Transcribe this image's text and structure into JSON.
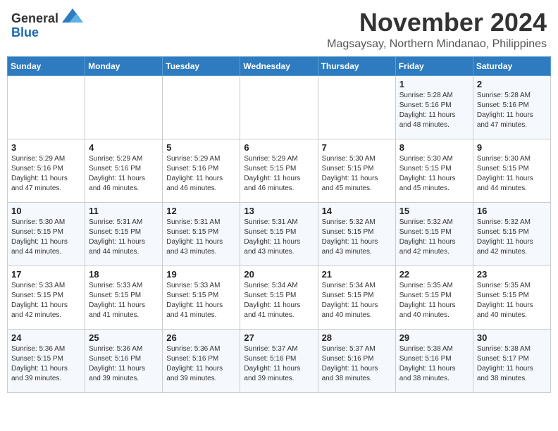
{
  "header": {
    "logo_general": "General",
    "logo_blue": "Blue",
    "month_title": "November 2024",
    "location": "Magsaysay, Northern Mindanao, Philippines"
  },
  "calendar": {
    "days_of_week": [
      "Sunday",
      "Monday",
      "Tuesday",
      "Wednesday",
      "Thursday",
      "Friday",
      "Saturday"
    ],
    "weeks": [
      [
        {
          "day": "",
          "info": ""
        },
        {
          "day": "",
          "info": ""
        },
        {
          "day": "",
          "info": ""
        },
        {
          "day": "",
          "info": ""
        },
        {
          "day": "",
          "info": ""
        },
        {
          "day": "1",
          "info": "Sunrise: 5:28 AM\nSunset: 5:16 PM\nDaylight: 11 hours and 48 minutes."
        },
        {
          "day": "2",
          "info": "Sunrise: 5:28 AM\nSunset: 5:16 PM\nDaylight: 11 hours and 47 minutes."
        }
      ],
      [
        {
          "day": "3",
          "info": "Sunrise: 5:29 AM\nSunset: 5:16 PM\nDaylight: 11 hours and 47 minutes."
        },
        {
          "day": "4",
          "info": "Sunrise: 5:29 AM\nSunset: 5:16 PM\nDaylight: 11 hours and 46 minutes."
        },
        {
          "day": "5",
          "info": "Sunrise: 5:29 AM\nSunset: 5:16 PM\nDaylight: 11 hours and 46 minutes."
        },
        {
          "day": "6",
          "info": "Sunrise: 5:29 AM\nSunset: 5:15 PM\nDaylight: 11 hours and 46 minutes."
        },
        {
          "day": "7",
          "info": "Sunrise: 5:30 AM\nSunset: 5:15 PM\nDaylight: 11 hours and 45 minutes."
        },
        {
          "day": "8",
          "info": "Sunrise: 5:30 AM\nSunset: 5:15 PM\nDaylight: 11 hours and 45 minutes."
        },
        {
          "day": "9",
          "info": "Sunrise: 5:30 AM\nSunset: 5:15 PM\nDaylight: 11 hours and 44 minutes."
        }
      ],
      [
        {
          "day": "10",
          "info": "Sunrise: 5:30 AM\nSunset: 5:15 PM\nDaylight: 11 hours and 44 minutes."
        },
        {
          "day": "11",
          "info": "Sunrise: 5:31 AM\nSunset: 5:15 PM\nDaylight: 11 hours and 44 minutes."
        },
        {
          "day": "12",
          "info": "Sunrise: 5:31 AM\nSunset: 5:15 PM\nDaylight: 11 hours and 43 minutes."
        },
        {
          "day": "13",
          "info": "Sunrise: 5:31 AM\nSunset: 5:15 PM\nDaylight: 11 hours and 43 minutes."
        },
        {
          "day": "14",
          "info": "Sunrise: 5:32 AM\nSunset: 5:15 PM\nDaylight: 11 hours and 43 minutes."
        },
        {
          "day": "15",
          "info": "Sunrise: 5:32 AM\nSunset: 5:15 PM\nDaylight: 11 hours and 42 minutes."
        },
        {
          "day": "16",
          "info": "Sunrise: 5:32 AM\nSunset: 5:15 PM\nDaylight: 11 hours and 42 minutes."
        }
      ],
      [
        {
          "day": "17",
          "info": "Sunrise: 5:33 AM\nSunset: 5:15 PM\nDaylight: 11 hours and 42 minutes."
        },
        {
          "day": "18",
          "info": "Sunrise: 5:33 AM\nSunset: 5:15 PM\nDaylight: 11 hours and 41 minutes."
        },
        {
          "day": "19",
          "info": "Sunrise: 5:33 AM\nSunset: 5:15 PM\nDaylight: 11 hours and 41 minutes."
        },
        {
          "day": "20",
          "info": "Sunrise: 5:34 AM\nSunset: 5:15 PM\nDaylight: 11 hours and 41 minutes."
        },
        {
          "day": "21",
          "info": "Sunrise: 5:34 AM\nSunset: 5:15 PM\nDaylight: 11 hours and 40 minutes."
        },
        {
          "day": "22",
          "info": "Sunrise: 5:35 AM\nSunset: 5:15 PM\nDaylight: 11 hours and 40 minutes."
        },
        {
          "day": "23",
          "info": "Sunrise: 5:35 AM\nSunset: 5:15 PM\nDaylight: 11 hours and 40 minutes."
        }
      ],
      [
        {
          "day": "24",
          "info": "Sunrise: 5:36 AM\nSunset: 5:15 PM\nDaylight: 11 hours and 39 minutes."
        },
        {
          "day": "25",
          "info": "Sunrise: 5:36 AM\nSunset: 5:16 PM\nDaylight: 11 hours and 39 minutes."
        },
        {
          "day": "26",
          "info": "Sunrise: 5:36 AM\nSunset: 5:16 PM\nDaylight: 11 hours and 39 minutes."
        },
        {
          "day": "27",
          "info": "Sunrise: 5:37 AM\nSunset: 5:16 PM\nDaylight: 11 hours and 39 minutes."
        },
        {
          "day": "28",
          "info": "Sunrise: 5:37 AM\nSunset: 5:16 PM\nDaylight: 11 hours and 38 minutes."
        },
        {
          "day": "29",
          "info": "Sunrise: 5:38 AM\nSunset: 5:16 PM\nDaylight: 11 hours and 38 minutes."
        },
        {
          "day": "30",
          "info": "Sunrise: 5:38 AM\nSunset: 5:17 PM\nDaylight: 11 hours and 38 minutes."
        }
      ]
    ]
  }
}
